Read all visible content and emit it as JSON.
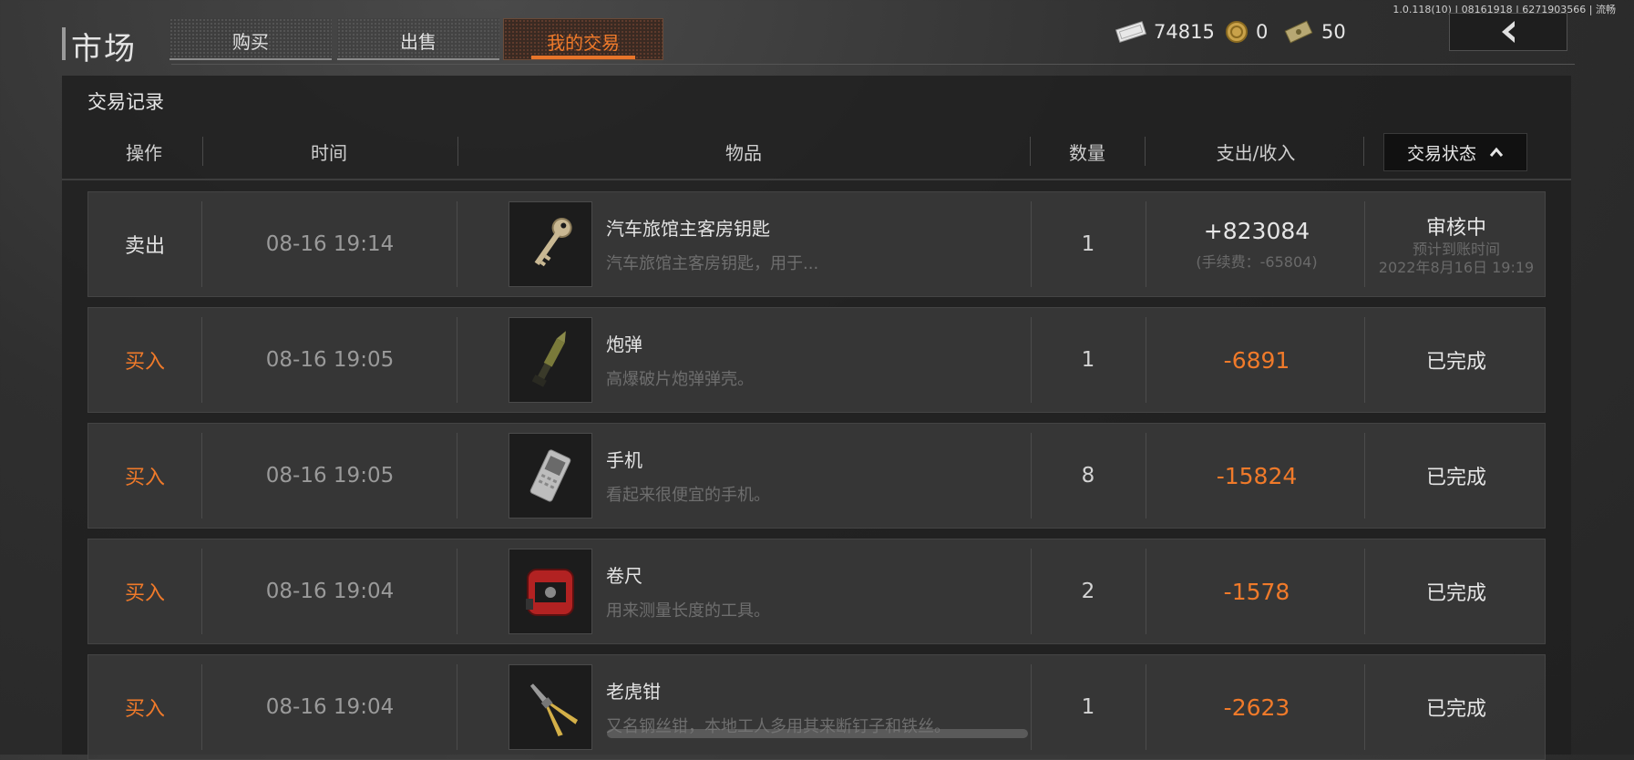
{
  "version_text": "1.0.118(10) | 08161918 | 6271903566 | 流畅",
  "header": {
    "title": "市场",
    "tabs": [
      {
        "label": "购买",
        "active": false
      },
      {
        "label": "出售",
        "active": false
      },
      {
        "label": "我的交易",
        "active": true
      }
    ]
  },
  "currencies": [
    {
      "icon": "cash-icon",
      "value": "74815"
    },
    {
      "icon": "coin-icon",
      "value": "0"
    },
    {
      "icon": "ticket-icon",
      "value": "50"
    }
  ],
  "section_title": "交易记录",
  "columns": {
    "op": "操作",
    "time": "时间",
    "item": "物品",
    "qty": "数量",
    "amount": "支出/收入",
    "status": "交易状态"
  },
  "rows": [
    {
      "op": "卖出",
      "op_type": "sell",
      "time": "08-16 19:14",
      "icon": "key-icon",
      "name": "汽车旅馆主客房钥匙",
      "desc": "汽车旅馆主客房钥匙，用于...",
      "qty": "1",
      "amount": "+823084",
      "amount_type": "pos",
      "fee": "(手续费：-65804)",
      "status": "审核中",
      "status_sub1": "预计到账时间",
      "status_sub2": "2022年8月16日 19:19"
    },
    {
      "op": "买入",
      "op_type": "buy",
      "time": "08-16 19:05",
      "icon": "shell-icon",
      "name": "炮弹",
      "desc": "高爆破片炮弹弹壳。",
      "qty": "1",
      "amount": "-6891",
      "amount_type": "neg",
      "fee": "",
      "status": "已完成",
      "status_sub1": "",
      "status_sub2": ""
    },
    {
      "op": "买入",
      "op_type": "buy",
      "time": "08-16 19:05",
      "icon": "phone-icon",
      "name": "手机",
      "desc": "看起来很便宜的手机。",
      "qty": "8",
      "amount": "-15824",
      "amount_type": "neg",
      "fee": "",
      "status": "已完成",
      "status_sub1": "",
      "status_sub2": ""
    },
    {
      "op": "买入",
      "op_type": "buy",
      "time": "08-16 19:04",
      "icon": "tape-measure-icon",
      "name": "卷尺",
      "desc": "用来测量长度的工具。",
      "qty": "2",
      "amount": "-1578",
      "amount_type": "neg",
      "fee": "",
      "status": "已完成",
      "status_sub1": "",
      "status_sub2": ""
    },
    {
      "op": "买入",
      "op_type": "buy",
      "time": "08-16 19:04",
      "icon": "pliers-icon",
      "name": "老虎钳",
      "desc": "又名钢丝钳，本地工人多用其来断钉子和铁丝。",
      "qty": "1",
      "amount": "-2623",
      "amount_type": "neg",
      "fee": "",
      "status": "已完成",
      "status_sub1": "",
      "status_sub2": ""
    }
  ],
  "colors": {
    "accent": "#f07a2a",
    "panel": "#202020",
    "row": "#3a3a3a"
  }
}
